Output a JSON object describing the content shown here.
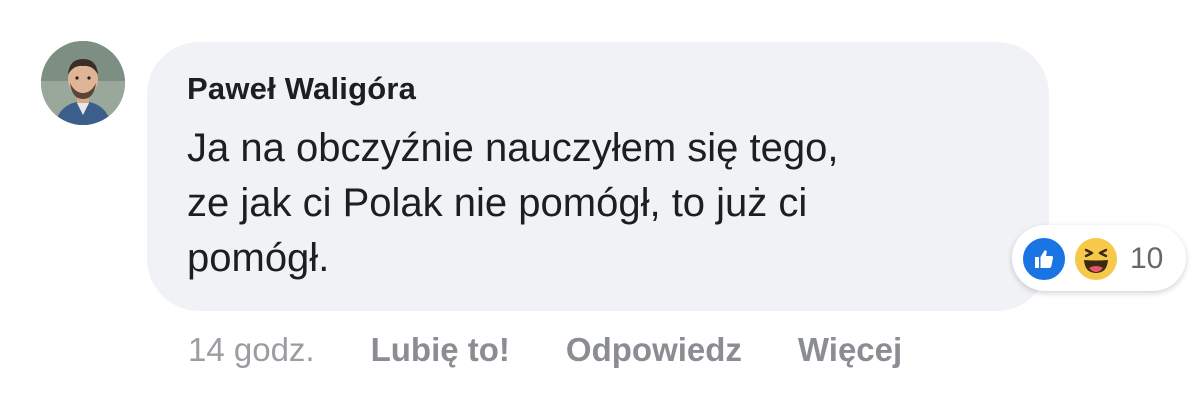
{
  "comment": {
    "author": "Paweł Waligóra",
    "message_lines": [
      "Ja na obczyźnie nauczyłem się tego,",
      "ze jak ci Polak nie pomógł, to już ci",
      "pomógł."
    ],
    "reactions": {
      "types": [
        "like-icon",
        "haha-icon"
      ],
      "count": "10"
    },
    "timestamp": "14 godz.",
    "actions": {
      "like": "Lubię to!",
      "reply": "Odpowiedz",
      "more": "Więcej"
    }
  },
  "colors": {
    "bubble": "#f0f2f5",
    "text": "#1c1e21",
    "secondary_text": "#8a8d91",
    "like_blue": "#1b74e4",
    "haha_yellow": "#f7c94b"
  }
}
